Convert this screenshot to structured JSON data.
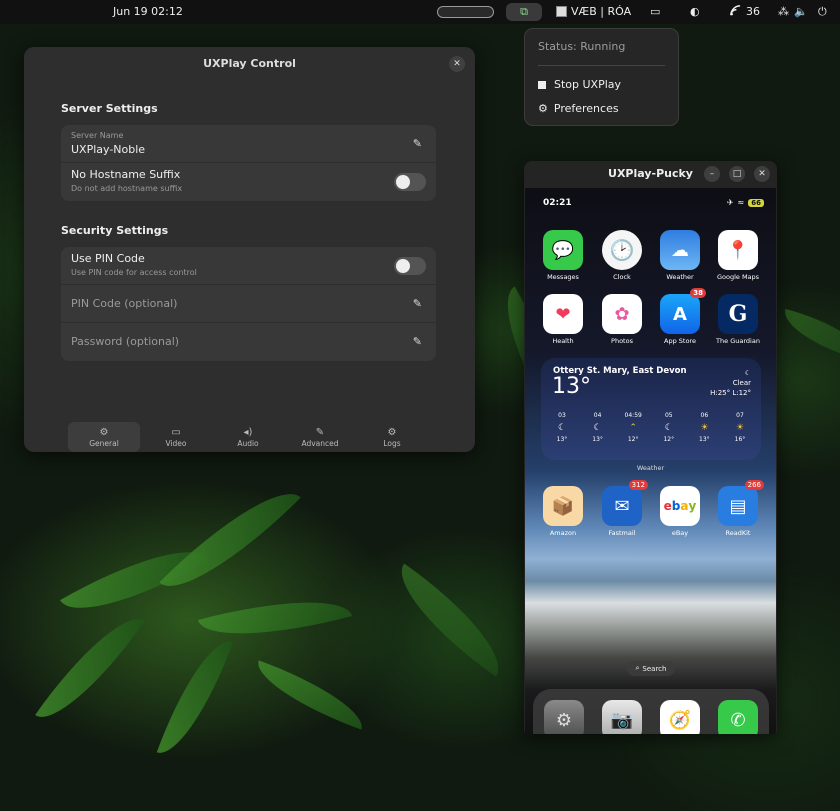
{
  "topbar": {
    "datetime": "Jun 19  02:12",
    "keyboard_layout": "VÆB | RÓA",
    "network_signal": "36",
    "icons": [
      "workspace-indicator",
      "uxplay-tray-icon",
      "keyboard-icon",
      "clipboard-icon",
      "night-light-icon",
      "wifi-icon",
      "network-icon",
      "volume-icon",
      "power-icon"
    ]
  },
  "tray_menu": {
    "status": "Status: Running",
    "stop_label": "Stop UXPlay",
    "preferences_label": "Preferences"
  },
  "control_window": {
    "title": "UXPlay Control",
    "server_settings_heading": "Server Settings",
    "server_name_label": "Server Name",
    "server_name_value": "UXPlay-Noble",
    "no_hostname_title": "No Hostname Suffix",
    "no_hostname_subtitle": "Do not add hostname suffix",
    "no_hostname_enabled": false,
    "security_settings_heading": "Security Settings",
    "use_pin_title": "Use PIN Code",
    "use_pin_subtitle": "Use PIN code for access control",
    "use_pin_enabled": false,
    "pin_placeholder": "PIN Code (optional)",
    "password_placeholder": "Password (optional)",
    "tabs": [
      {
        "label": "General",
        "icon": "gear-icon",
        "active": true
      },
      {
        "label": "Video",
        "icon": "monitor-icon",
        "active": false
      },
      {
        "label": "Audio",
        "icon": "speaker-icon",
        "active": false
      },
      {
        "label": "Advanced",
        "icon": "pen-icon",
        "active": false
      },
      {
        "label": "Logs",
        "icon": "gear-icon",
        "active": false
      }
    ]
  },
  "mirror_window": {
    "title": "UXPlay-Pucky",
    "phone": {
      "time": "02:21",
      "battery": "66",
      "apps_row1": [
        {
          "name": "Messages",
          "badge": ""
        },
        {
          "name": "Clock",
          "badge": ""
        },
        {
          "name": "Weather",
          "badge": ""
        },
        {
          "name": "Google Maps",
          "badge": ""
        }
      ],
      "apps_row2": [
        {
          "name": "Health",
          "badge": ""
        },
        {
          "name": "Photos",
          "badge": ""
        },
        {
          "name": "App Store",
          "badge": "38"
        },
        {
          "name": "The Guardian",
          "badge": ""
        }
      ],
      "weather_widget": {
        "location": "Ottery St. Mary, East Devon",
        "temp": "13°",
        "condition": "Clear",
        "hi_lo": "H:25° L:12°",
        "hours": [
          {
            "time": "03",
            "icon": "moon",
            "temp": "13°"
          },
          {
            "time": "04",
            "icon": "moon",
            "temp": "13°"
          },
          {
            "time": "04:59",
            "icon": "sunrise",
            "temp": "12°"
          },
          {
            "time": "05",
            "icon": "moon",
            "temp": "12°"
          },
          {
            "time": "06",
            "icon": "sun",
            "temp": "13°"
          },
          {
            "time": "07",
            "icon": "sun",
            "temp": "16°"
          }
        ],
        "label": "Weather"
      },
      "apps_row3": [
        {
          "name": "Amazon",
          "badge": ""
        },
        {
          "name": "Fastmail",
          "badge": "312"
        },
        {
          "name": "eBay",
          "badge": ""
        },
        {
          "name": "ReadKit",
          "badge": "266"
        }
      ],
      "search_label": "Search",
      "dock": [
        "Settings",
        "Camera",
        "Safari",
        "Phone"
      ]
    }
  }
}
